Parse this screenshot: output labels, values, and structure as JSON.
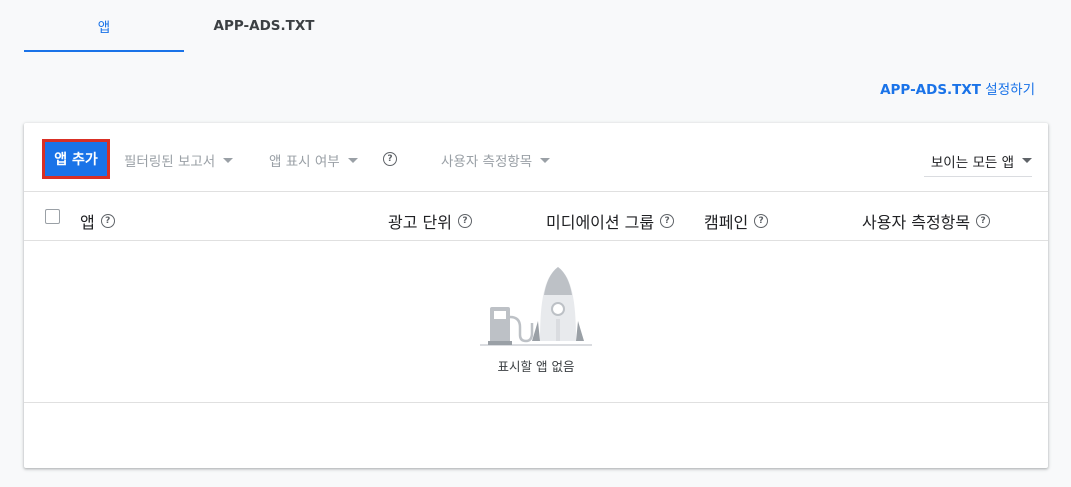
{
  "tabs": [
    {
      "label": "앱"
    },
    {
      "label": "APP-ADS.TXT"
    }
  ],
  "setup_link": {
    "bold": "APP-ADS.TXT",
    "rest": " 설정하기"
  },
  "toolbar": {
    "add_app": "앱 추가",
    "filtered_reports": "필터링된 보고서",
    "app_visibility": "앱 표시 여부",
    "custom_metrics": "사용자 측정항목",
    "visible_apps": "보이는 모든 앱",
    "help_glyph": "?"
  },
  "table": {
    "columns": [
      "앱",
      "광고 단위",
      "미디에이션 그룹",
      "캠페인",
      "사용자 측정항목"
    ]
  },
  "empty_state": {
    "message": "표시할 앱 없음"
  },
  "colors": {
    "accent": "#1a73e8",
    "highlight_border": "#d93025",
    "background": "#f8f9fa"
  }
}
